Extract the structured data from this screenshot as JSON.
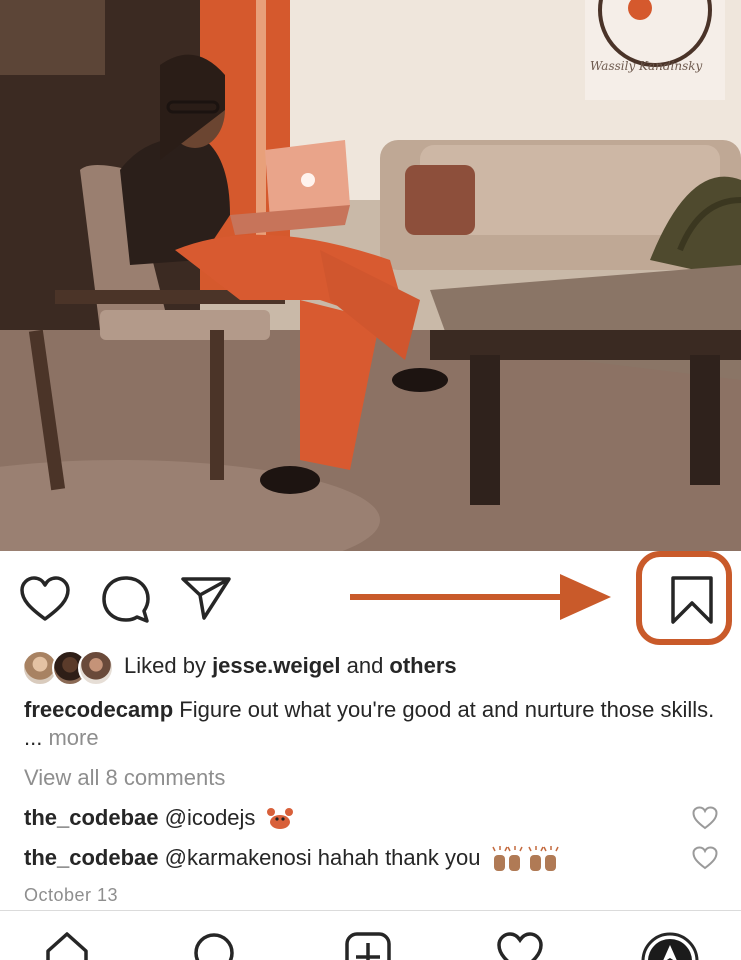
{
  "post": {
    "photo": {
      "description_icon": "photo-of-woman-with-laptop",
      "poster_text": "Wassily Kandinsky"
    },
    "actions": {
      "like_icon": "heart-icon",
      "comment_icon": "comment-icon",
      "share_icon": "paper-plane-icon",
      "save_icon": "bookmark-icon",
      "highlight_color": "#c95a2a"
    },
    "likes": {
      "prefix": "Liked by ",
      "user": "jesse.weigel",
      "middle": " and ",
      "suffix": "others"
    },
    "caption": {
      "username": "freecodecamp",
      "text": " Figure out what you're good at and nurture those skills. ... ",
      "more": "more"
    },
    "view_all_comments": "View all 8 comments",
    "comments": [
      {
        "username": "the_codebae",
        "text": " @icodejs "
      },
      {
        "username": "the_codebae",
        "text": " @karmakenosi hahah thank you "
      }
    ],
    "date": "October 13"
  },
  "bottom_nav": {
    "items": [
      "home-icon",
      "search-icon",
      "add-post-icon",
      "activity-icon",
      "profile-icon"
    ]
  }
}
